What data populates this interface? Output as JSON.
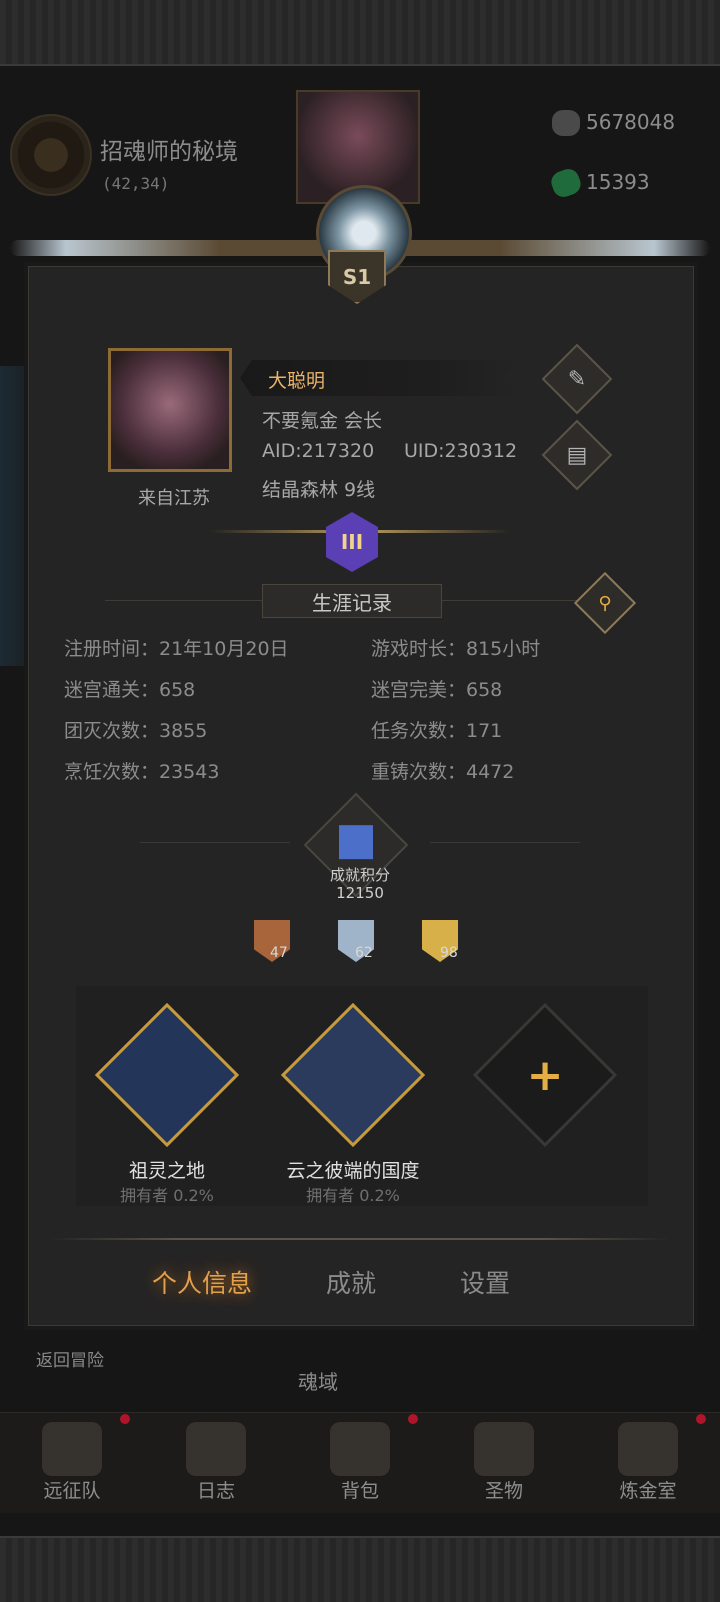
{
  "background": {
    "location_title": "招魂师的秘境",
    "location_coords": "(42,34)",
    "resources": [
      {
        "icon": "stone-currency-icon",
        "value": "5678048"
      },
      {
        "icon": "emerald-gem-icon",
        "value": "15393"
      }
    ],
    "return_label": "返回冒险",
    "soul_domain_label": "魂域"
  },
  "profile": {
    "season_badge": "S1",
    "name": "大聪明",
    "guild_line": "不要氪金 会长",
    "aid": "AID:217320",
    "uid": "UID:230312",
    "server": "结晶森林 9线",
    "from": "来自江苏",
    "rank_numeral": "III"
  },
  "career": {
    "title": "生涯记录",
    "stats": [
      {
        "label": "注册时间：21年10月20日"
      },
      {
        "label": "游戏时长：815小时"
      },
      {
        "label": "迷宫通关：658"
      },
      {
        "label": "迷宫完美：658"
      },
      {
        "label": "团灭次数：3855"
      },
      {
        "label": "任务次数：171"
      },
      {
        "label": "烹饪次数：23543"
      },
      {
        "label": "重铸次数：4472"
      }
    ]
  },
  "achievements": {
    "score_label": "成就积分",
    "score_value": "12150",
    "medals": [
      {
        "tier": "bronze",
        "count": "47",
        "color": "#a8643a"
      },
      {
        "tier": "silver",
        "count": "62",
        "color": "#9fb3c9"
      },
      {
        "tier": "gold",
        "count": "98",
        "color": "#d7b04a"
      }
    ],
    "cards": [
      {
        "name": "祖灵之地",
        "owners": "拥有者 0.2%"
      },
      {
        "name": "云之彼端的国度",
        "owners": "拥有者 0.2%"
      }
    ]
  },
  "tabs": [
    {
      "label": "个人信息",
      "active": true
    },
    {
      "label": "成就",
      "active": false
    },
    {
      "label": "设置",
      "active": false
    }
  ],
  "bottom_nav": [
    {
      "label": "远征队",
      "icon": "helmet-icon"
    },
    {
      "label": "日志",
      "icon": "scroll-icon"
    },
    {
      "label": "背包",
      "icon": "backpack-icon"
    },
    {
      "label": "圣物",
      "icon": "relic-icon"
    },
    {
      "label": "炼金室",
      "icon": "alchemy-icon"
    }
  ],
  "colors": {
    "accent_gold": "#e2a04c",
    "name_color": "#e8b46a",
    "notification_dot": "#b0142a"
  }
}
